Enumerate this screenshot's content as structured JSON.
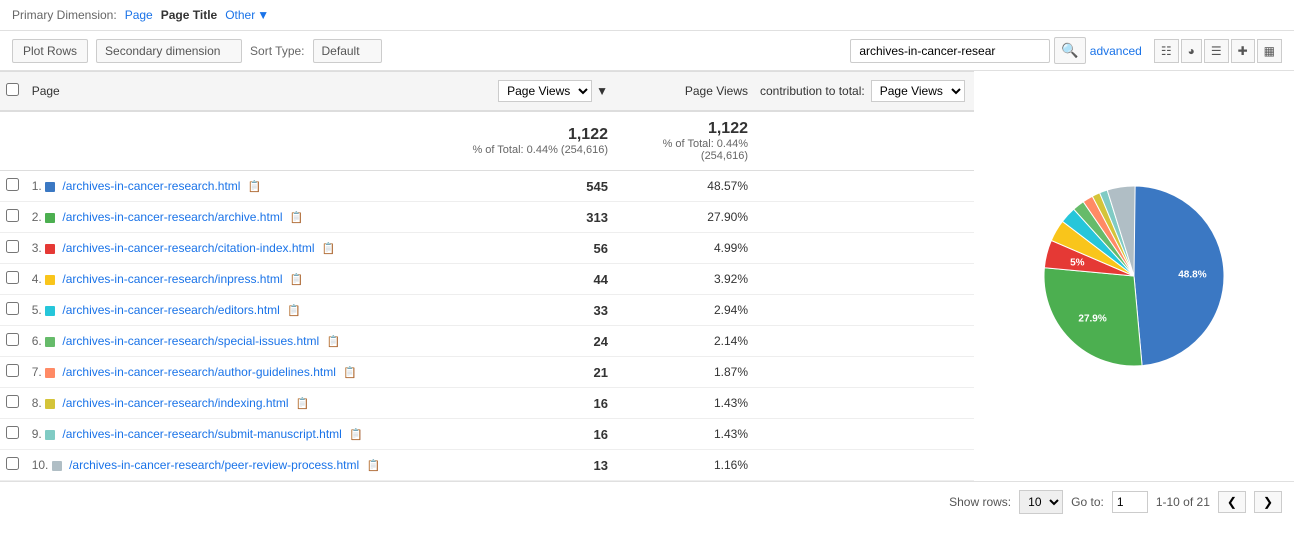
{
  "primaryDimension": {
    "label": "Primary Dimension:",
    "options": [
      {
        "id": "page",
        "label": "Page",
        "active": false
      },
      {
        "id": "page-title",
        "label": "Page Title",
        "active": true
      },
      {
        "id": "other",
        "label": "Other",
        "active": false
      }
    ]
  },
  "toolbar": {
    "plotRowsLabel": "Plot Rows",
    "secondaryDimensionLabel": "Secondary dimension",
    "sortTypeLabel": "Sort Type:",
    "sortDefault": "Default",
    "searchPlaceholder": "archives-in-cancer-resear",
    "advancedLabel": "advanced"
  },
  "table": {
    "headers": {
      "page": "Page",
      "metricSelect": "Page Views",
      "pageViews": "Page Views",
      "contribution": "contribution to total:",
      "contributionMetric": "Page Views"
    },
    "totals": {
      "value": "1,122",
      "sub": "% of Total: 0.44% (254,616)",
      "value2": "1,122",
      "sub2": "% of Total: 0.44% (254,616)"
    },
    "rows": [
      {
        "num": 1,
        "color": "#3b78c3",
        "page": "/archives-in-cancer-research.html",
        "views": "545",
        "percent": "48.57%"
      },
      {
        "num": 2,
        "color": "#4caf50",
        "page": "/archives-in-cancer-research/archive.html",
        "views": "313",
        "percent": "27.90%"
      },
      {
        "num": 3,
        "color": "#e53935",
        "page": "/archives-in-cancer-research/citation-index.html",
        "views": "56",
        "percent": "4.99%"
      },
      {
        "num": 4,
        "color": "#f9c51b",
        "page": "/archives-in-cancer-research/inpress.html",
        "views": "44",
        "percent": "3.92%"
      },
      {
        "num": 5,
        "color": "#26c6da",
        "page": "/archives-in-cancer-research/editors.html",
        "views": "33",
        "percent": "2.94%"
      },
      {
        "num": 6,
        "color": "#66bb6a",
        "page": "/archives-in-cancer-research/special-issues.html",
        "views": "24",
        "percent": "2.14%"
      },
      {
        "num": 7,
        "color": "#ff8a65",
        "page": "/archives-in-cancer-research/author-guidelines.html",
        "views": "21",
        "percent": "1.87%"
      },
      {
        "num": 8,
        "color": "#d4c439",
        "page": "/archives-in-cancer-research/indexing.html",
        "views": "16",
        "percent": "1.43%"
      },
      {
        "num": 9,
        "color": "#80cbc4",
        "page": "/archives-in-cancer-research/submit-manuscript.html",
        "views": "16",
        "percent": "1.43%"
      },
      {
        "num": 10,
        "color": "#b0bec5",
        "page": "/archives-in-cancer-research/peer-review-process.html",
        "views": "13",
        "percent": "1.16%"
      }
    ]
  },
  "pie": {
    "segments": [
      {
        "color": "#3b78c3",
        "percent": 48.57,
        "label": "48.8%"
      },
      {
        "color": "#4caf50",
        "percent": 27.9,
        "label": "27.9%"
      },
      {
        "color": "#e53935",
        "percent": 4.99,
        "label": "5%"
      },
      {
        "color": "#f9c51b",
        "percent": 3.92,
        "label": ""
      },
      {
        "color": "#26c6da",
        "percent": 2.94,
        "label": ""
      },
      {
        "color": "#66bb6a",
        "percent": 2.14,
        "label": ""
      },
      {
        "color": "#ff8a65",
        "percent": 1.87,
        "label": ""
      },
      {
        "color": "#d4c439",
        "percent": 1.43,
        "label": ""
      },
      {
        "color": "#80cbc4",
        "percent": 1.43,
        "label": ""
      },
      {
        "color": "#b0bec5",
        "percent": 5.01,
        "label": ""
      }
    ]
  },
  "footer": {
    "showRowsLabel": "Show rows:",
    "showRowsValue": "10",
    "goToLabel": "Go to:",
    "goToValue": "1",
    "rangeLabel": "1-10 of 21"
  }
}
